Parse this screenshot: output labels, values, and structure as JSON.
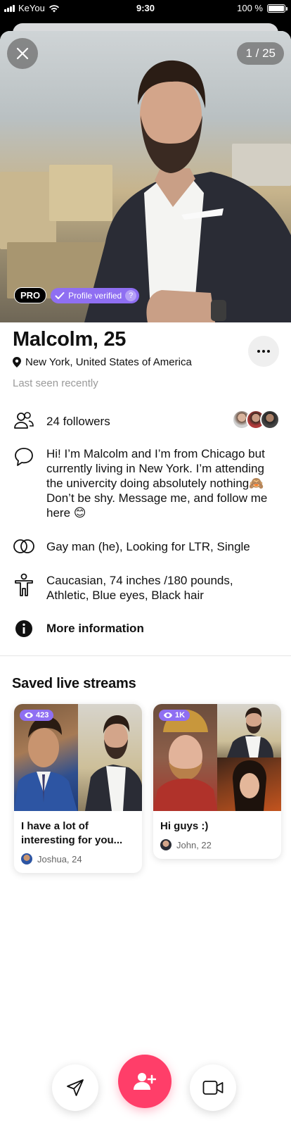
{
  "status_bar": {
    "carrier": "KeYou",
    "time": "9:30",
    "battery": "100 %"
  },
  "photo": {
    "counter": "1 / 25",
    "pro_badge": "PRO",
    "verified_label": "Profile verified",
    "verified_help": "?"
  },
  "profile": {
    "name_age": "Malcolm, 25",
    "location": "New York, United States of America",
    "last_seen": "Last seen recently"
  },
  "info": {
    "followers": "24 followers",
    "bio": "Hi! I’m Malcolm and I’m from Chicago but currently living in New York. I’m attending the univercity doing absolutely nothing🙈 Don’t be shy. Message me, and follow me here 😊",
    "orientation": "Gay man (he), Looking for LTR, Single",
    "appearance": "Caucasian, 74 inches /180 pounds, Athletic, Blue eyes, Black hair",
    "more": "More information"
  },
  "saved_streams": {
    "title": "Saved live streams",
    "cards": [
      {
        "views": "423",
        "title": "I have a lot of interesting for you...",
        "author": "Joshua, 24"
      },
      {
        "views": "1K",
        "title": "Hi guys :)",
        "author": "John, 22"
      }
    ]
  },
  "colors": {
    "accent_pink": "#ff3e69",
    "accent_purple": "#8f6ff2"
  }
}
